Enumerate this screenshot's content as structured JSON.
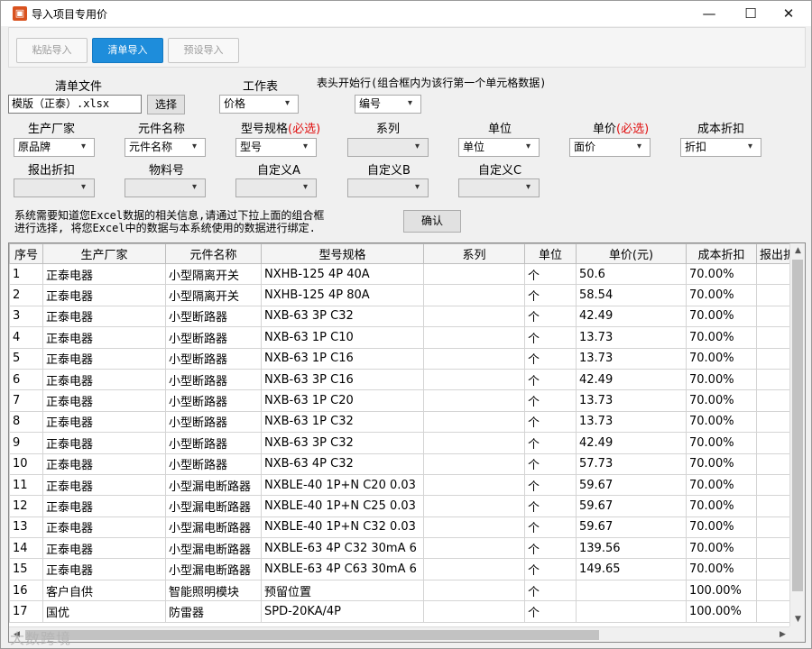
{
  "window": {
    "title": "导入项目专用价",
    "icon": "app-icon",
    "minimize": "—",
    "maximize": "☐",
    "close": "✕"
  },
  "toolbar": {
    "paste_import": "粘贴导入",
    "list_import": "清单导入",
    "preset_import": "预设导入"
  },
  "form": {
    "list_file_label": "清单文件",
    "list_file_value": "模版（正泰）.xlsx",
    "select_button": "选择",
    "sheet_label": "工作表",
    "sheet_value": "价格",
    "header_row_label": "表头开始行(组合框内为该行第一个单元格数据)",
    "header_row_value": "编号",
    "manufacturer_label": "生产厂家",
    "manufacturer_value": "原品牌",
    "component_label": "元件名称",
    "component_value": "元件名称",
    "model_label": "型号规格",
    "model_required": "(必选)",
    "model_value": "型号",
    "series_label": "系列",
    "series_value": "",
    "unit_label": "单位",
    "unit_value": "单位",
    "price_label": "单价",
    "price_required": "(必选)",
    "price_value": "面价",
    "cost_discount_label": "成本折扣",
    "cost_discount_value": "折扣",
    "quote_discount_label": "报出折扣",
    "material_no_label": "物料号",
    "custom_a_label": "自定义A",
    "custom_b_label": "自定义B",
    "custom_c_label": "自定义C",
    "info_line1": "系统需要知道您Excel数据的相关信息,请通过下拉上面的组合框",
    "info_line2": "进行选择, 将您Excel中的数据与本系统使用的数据进行绑定.",
    "confirm_button": "确认"
  },
  "grid": {
    "headers": [
      "序号",
      "生产厂家",
      "元件名称",
      "型号规格",
      "系列",
      "单位",
      "单价(元)",
      "成本折扣",
      "报出折"
    ],
    "rows": [
      [
        "1",
        "正泰电器",
        "小型隔离开关",
        "NXHB-125 4P 40A",
        "",
        "个",
        "50.6",
        "70.00%",
        ""
      ],
      [
        "2",
        "正泰电器",
        "小型隔离开关",
        "NXHB-125 4P 80A",
        "",
        "个",
        "58.54",
        "70.00%",
        ""
      ],
      [
        "3",
        "正泰电器",
        "小型断路器",
        "NXB-63 3P C32",
        "",
        "个",
        "42.49",
        "70.00%",
        ""
      ],
      [
        "4",
        "正泰电器",
        "小型断路器",
        "NXB-63 1P C10",
        "",
        "个",
        "13.73",
        "70.00%",
        ""
      ],
      [
        "5",
        "正泰电器",
        "小型断路器",
        "NXB-63 1P C16",
        "",
        "个",
        "13.73",
        "70.00%",
        ""
      ],
      [
        "6",
        "正泰电器",
        "小型断路器",
        "NXB-63 3P C16",
        "",
        "个",
        "42.49",
        "70.00%",
        ""
      ],
      [
        "7",
        "正泰电器",
        "小型断路器",
        "NXB-63 1P C20",
        "",
        "个",
        "13.73",
        "70.00%",
        ""
      ],
      [
        "8",
        "正泰电器",
        "小型断路器",
        "NXB-63 1P C32",
        "",
        "个",
        "13.73",
        "70.00%",
        ""
      ],
      [
        "9",
        "正泰电器",
        "小型断路器",
        "NXB-63 3P C32",
        "",
        "个",
        "42.49",
        "70.00%",
        ""
      ],
      [
        "10",
        "正泰电器",
        "小型断路器",
        "NXB-63 4P C32",
        "",
        "个",
        "57.73",
        "70.00%",
        ""
      ],
      [
        "11",
        "正泰电器",
        "小型漏电断路器",
        "NXBLE-40 1P+N C20 0.03",
        "",
        "个",
        "59.67",
        "70.00%",
        ""
      ],
      [
        "12",
        "正泰电器",
        "小型漏电断路器",
        "NXBLE-40 1P+N C25 0.03",
        "",
        "个",
        "59.67",
        "70.00%",
        ""
      ],
      [
        "13",
        "正泰电器",
        "小型漏电断路器",
        "NXBLE-40 1P+N C32 0.03",
        "",
        "个",
        "59.67",
        "70.00%",
        ""
      ],
      [
        "14",
        "正泰电器",
        "小型漏电断路器",
        "NXBLE-63 4P C32 30mA 6",
        "",
        "个",
        "139.56",
        "70.00%",
        ""
      ],
      [
        "15",
        "正泰电器",
        "小型漏电断路器",
        "NXBLE-63 4P C63 30mA 6",
        "",
        "个",
        "149.65",
        "70.00%",
        ""
      ],
      [
        "16",
        "客户自供",
        "智能照明模块",
        "预留位置",
        "",
        "个",
        "",
        "100.00%",
        ""
      ],
      [
        "17",
        "国优",
        "防雷器",
        "SPD-20KA/4P",
        "",
        "个",
        "",
        "100.00%",
        ""
      ]
    ]
  },
  "watermark": "大数跨境"
}
